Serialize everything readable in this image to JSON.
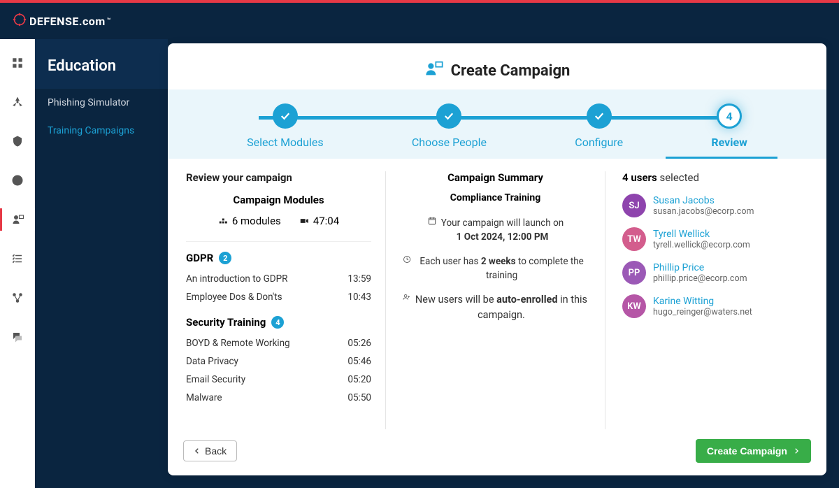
{
  "brand": {
    "name": "DEFENSE.com",
    "tm": "™"
  },
  "sidebar": {
    "title": "Education",
    "items": [
      {
        "label": "Phishing Simulator"
      },
      {
        "label": "Training Campaigns"
      }
    ],
    "active_index": 1
  },
  "page": {
    "title": "Create Campaign"
  },
  "stepper": {
    "steps": [
      {
        "label": "Select Modules",
        "done": true
      },
      {
        "label": "Choose People",
        "done": true
      },
      {
        "label": "Configure",
        "done": true
      },
      {
        "label": "Review",
        "number": "4",
        "active": true
      }
    ]
  },
  "review": {
    "heading": "Review your campaign",
    "modules_heading": "Campaign Modules",
    "module_count_text": "6 modules",
    "total_duration": "47:04",
    "groups": [
      {
        "name": "GDPR",
        "count": "2",
        "modules": [
          {
            "name": "An introduction to GDPR",
            "duration": "13:59"
          },
          {
            "name": "Employee Dos & Don'ts",
            "duration": "10:43"
          }
        ]
      },
      {
        "name": "Security Training",
        "count": "4",
        "modules": [
          {
            "name": "BOYD & Remote Working",
            "duration": "05:26"
          },
          {
            "name": "Data Privacy",
            "duration": "05:46"
          },
          {
            "name": "Email Security",
            "duration": "05:20"
          },
          {
            "name": "Malware",
            "duration": "05:50"
          }
        ]
      }
    ]
  },
  "summary": {
    "heading": "Campaign Summary",
    "name": "Compliance Training",
    "launch_prefix": "Your campaign will launch on",
    "launch_date": "1 Oct 2024, 12:00 PM",
    "deadline_prefix": "Each user has",
    "deadline_bold": "2 weeks",
    "deadline_suffix": "to complete the training",
    "autoenroll_prefix": "New users will be",
    "autoenroll_bold": "auto-enrolled",
    "autoenroll_suffix": "in this campaign."
  },
  "users": {
    "count": "4 users",
    "suffix": "selected",
    "list": [
      {
        "initials": "SJ",
        "name": "Susan Jacobs",
        "email": "susan.jacobs@ecorp.com",
        "color": "#8e44ad"
      },
      {
        "initials": "TW",
        "name": "Tyrell Wellick",
        "email": "tyrell.wellick@ecorp.com",
        "color": "#d35d8d"
      },
      {
        "initials": "PP",
        "name": "Phillip Price",
        "email": "phillip.price@ecorp.com",
        "color": "#9b59b6"
      },
      {
        "initials": "KW",
        "name": "Karine Witting",
        "email": "hugo_reinger@waters.net",
        "color": "#b556a6"
      }
    ]
  },
  "footer": {
    "back": "Back",
    "submit": "Create Campaign"
  }
}
